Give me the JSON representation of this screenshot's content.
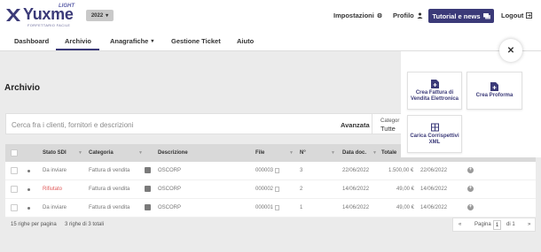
{
  "header": {
    "logo_name": "Yuxme",
    "logo_tag": "LIGHT",
    "logo_sub": "FORFETTARIO FACILE",
    "year": "2022",
    "impostazioni": "Impostazioni",
    "profilo": "Profilo",
    "tutorial": "Tutorial e news",
    "logout": "Logout"
  },
  "nav": {
    "dashboard": "Dashboard",
    "archivio": "Archivio",
    "anagrafiche": "Anagrafiche",
    "gestione": "Gestione Ticket",
    "aiuto": "Aiuto"
  },
  "page": {
    "title": "Archivio",
    "search_placeholder": "Cerca fra i clienti, fornitori e descrizioni",
    "avanzata": "Avanzata",
    "categoria_label": "Categor",
    "categoria_value": "Tutte"
  },
  "table": {
    "headers": {
      "stato": "Stato SDI",
      "categoria": "Categoria",
      "descrizione": "Descrizione",
      "file": "File",
      "num": "N°",
      "data": "Data doc.",
      "totale": "Totale"
    },
    "rows": [
      {
        "stato": "Da inviare",
        "categoria": "Fattura di vendita",
        "descrizione": "OSCORP",
        "file": "000003",
        "num": "3",
        "data": "22/06/2022",
        "totale": "1.500,00 €",
        "data2": "22/06/2022"
      },
      {
        "stato": "Rifiutato",
        "categoria": "Fattura di vendita",
        "descrizione": "OSCORP",
        "file": "000002",
        "num": "2",
        "data": "14/06/2022",
        "totale": "49,00 €",
        "data2": "14/06/2022"
      },
      {
        "stato": "Da inviare",
        "categoria": "Fattura di vendita",
        "descrizione": "OSCORP",
        "file": "000001",
        "num": "1",
        "data": "14/06/2022",
        "totale": "49,00 €",
        "data2": "14/06/2022"
      }
    ],
    "footer": {
      "per_page": "15 righe per pagina",
      "count": "3 righe di 3 totali"
    },
    "pager": {
      "label": "Pagina",
      "current": "1",
      "of": "di 1"
    }
  },
  "panel": {
    "tile1": "Crea Fattura di Vendita Elettronica",
    "tile2": "Crea Proforma",
    "tile3": "Carica Corrispettivi XML"
  },
  "colors": {
    "brand": "#3b3a78",
    "rejected": "#e05a5a"
  }
}
